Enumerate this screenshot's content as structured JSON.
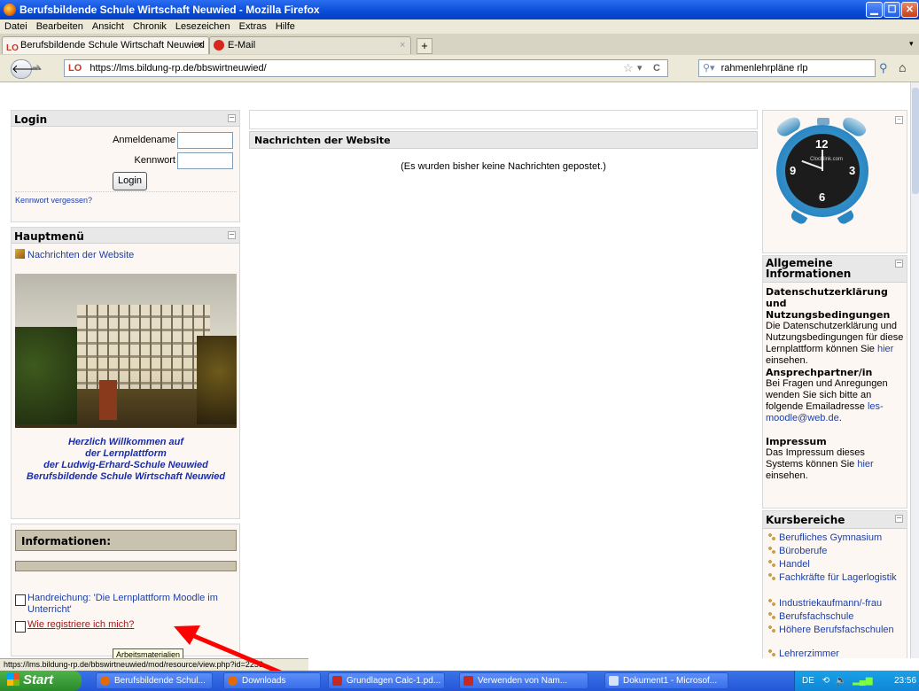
{
  "window": {
    "title": "Berufsbildende Schule Wirtschaft Neuwied - Mozilla Firefox"
  },
  "menu": [
    "Datei",
    "Bearbeiten",
    "Ansicht",
    "Chronik",
    "Lesezeichen",
    "Extras",
    "Hilfe"
  ],
  "tabs": [
    {
      "label": "Berufsbildende Schule Wirtschaft Neuwied",
      "close": "×"
    },
    {
      "label": "E-Mail",
      "close": "×"
    }
  ],
  "new_tab": "+",
  "nav": {
    "url": "https://lms.bildung-rp.de/bbswirtneuwied/",
    "search_value": "rahmenlehrpläne rlp"
  },
  "login": {
    "title": "Login",
    "username_label": "Anmeldename",
    "password_label": "Kennwort",
    "button": "Login",
    "forgot": "Kennwort vergessen?"
  },
  "mainmenu": {
    "title": "Hauptmenü",
    "item": "Nachrichten der Website",
    "welcome_lines": [
      "Herzlich Willkommen auf",
      "der Lernplattform",
      "der Ludwig-Erhard-Schule Neuwied",
      "Berufsbildende Schule Wirtschaft Neuwied"
    ]
  },
  "informationen": {
    "title": "Informationen:"
  },
  "resources": [
    {
      "label": "Handreichung: 'Die Lernplattform Moodle im Unterricht'"
    },
    {
      "label": "Wie registriere ich mich?"
    }
  ],
  "tooltip": "Arbeitsmaterialien",
  "status_url": "https://lms.bildung-rp.de/bbswirtneuwied/mod/resource/view.php?id=2258",
  "news": {
    "title": "Nachrichten der Website",
    "empty": "(Es wurden bisher keine Nachrichten gepostet.)"
  },
  "clock": {
    "brand": "Clocklink.com",
    "n12": "12",
    "n3": "3",
    "n6": "6",
    "n9": "9"
  },
  "general_info": {
    "title": "Allgemeine Informationen",
    "privacy_heading": "Datenschutzerklärung und Nutzungsbedingungen",
    "privacy_text": "Die Datenschutzerklärung und Nutzungsbedingungen für diese Lernplattform können Sie",
    "privacy_link": "hier",
    "privacy_end": "einsehen.",
    "contact_heading": "Ansprechpartner/in",
    "contact_text": "Bei Fragen und Anregungen wenden Sie sich bitte an folgende Emailadresse",
    "contact_email": "les-moodle@web.de",
    "contact_end": ".",
    "impressum_heading": "Impressum",
    "impressum_text": "Das Impressum dieses Systems können Sie",
    "impressum_link": "hier",
    "impressum_end": "einsehen."
  },
  "kursbereiche": {
    "title": "Kursbereiche",
    "items": [
      "Berufliches Gymnasium",
      "Büroberufe",
      "Handel",
      "Fachkräfte für Lagerlogistik",
      "Industriekaufmann/-frau",
      "Berufsfachschule",
      "Höhere Berufsfachschulen",
      "Lehrerzimmer"
    ]
  },
  "taskbar": {
    "start": "Start",
    "tasks": [
      "Berufsbildende Schul...",
      "Downloads",
      "Grundlagen Calc-1.pd...",
      "Verwenden von Nam...",
      "Dokument1 - Microsof..."
    ],
    "lang": "DE",
    "time": "23:56"
  },
  "colors": {
    "accent": "#1c3fa8",
    "welcome": "#1a2ea8",
    "title_bar": "#0a4bd8",
    "annotation_arrow": "#ff0000"
  }
}
